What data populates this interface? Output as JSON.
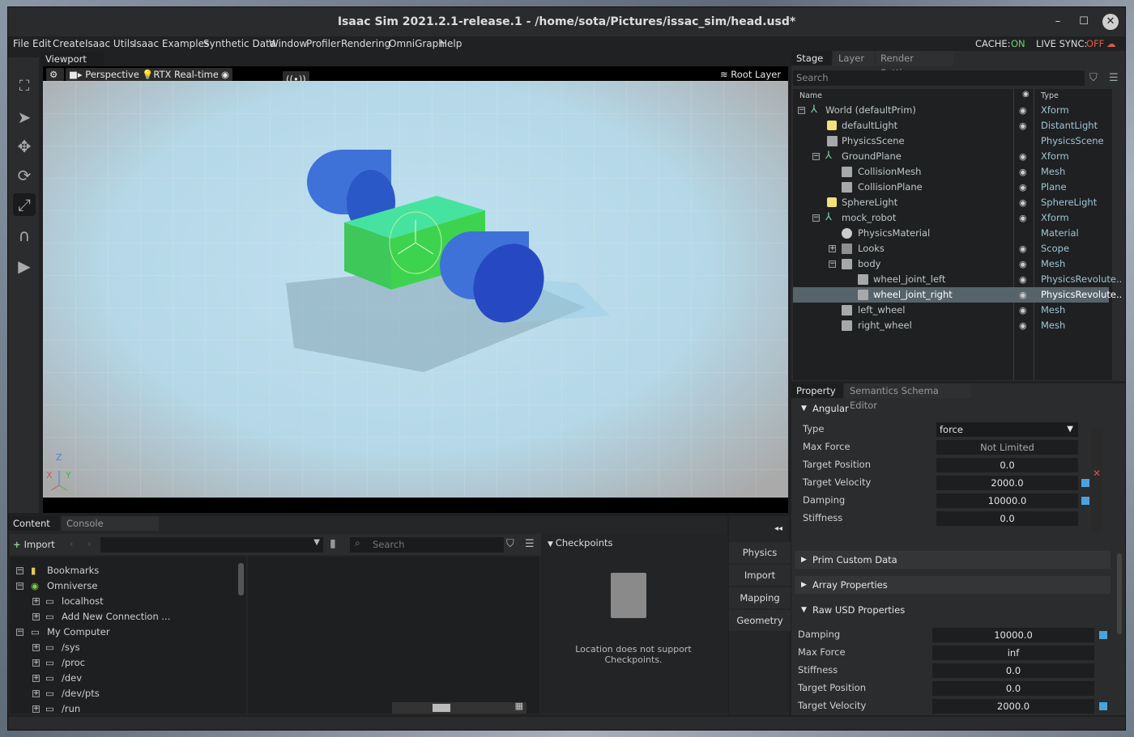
{
  "window": {
    "title": "Isaac Sim 2021.2.1-release.1 - /home/sota/Pictures/issac_sim/head.usd*",
    "minimize": "–",
    "maximize": "☐",
    "close": "✕"
  },
  "menu": [
    "File",
    "Edit",
    "Create",
    "Isaac Utils",
    "Isaac Examples",
    "Synthetic Data",
    "Window",
    "Profiler",
    "Rendering",
    "OmniGraph",
    "Help"
  ],
  "status": {
    "cache_label": "CACHE:",
    "cache_value": "ON",
    "live_label": "LIVE SYNC:",
    "live_value": "OFF"
  },
  "viewport": {
    "tab": "Viewport",
    "camera": "Perspective",
    "renderer": "RTX Real-time",
    "root_layer": "Root Layer",
    "axis_z": "Z",
    "axis_x": "X",
    "axis_y": "Y"
  },
  "stage": {
    "tabs": [
      "Stage",
      "Layer",
      "Render Settings"
    ],
    "search_placeholder": "Search",
    "col_name": "Name",
    "col_type": "Type",
    "rows": [
      {
        "name": "World (defaultPrim)",
        "type": "Xform",
        "eye": true
      },
      {
        "name": "defaultLight",
        "type": "DistantLight",
        "eye": true
      },
      {
        "name": "PhysicsScene",
        "type": "PhysicsScene",
        "eye": false
      },
      {
        "name": "GroundPlane",
        "type": "Xform",
        "eye": true
      },
      {
        "name": "CollisionMesh",
        "type": "Mesh",
        "eye": true
      },
      {
        "name": "CollisionPlane",
        "type": "Plane",
        "eye": true
      },
      {
        "name": "SphereLight",
        "type": "SphereLight",
        "eye": true
      },
      {
        "name": "mock_robot",
        "type": "Xform",
        "eye": true
      },
      {
        "name": "PhysicsMaterial",
        "type": "Material",
        "eye": false
      },
      {
        "name": "Looks",
        "type": "Scope",
        "eye": true
      },
      {
        "name": "body",
        "type": "Mesh",
        "eye": true
      },
      {
        "name": "wheel_joint_left",
        "type": "PhysicsRevolute..",
        "eye": true
      },
      {
        "name": "wheel_joint_right",
        "type": "PhysicsRevolute..",
        "eye": true
      },
      {
        "name": "left_wheel",
        "type": "Mesh",
        "eye": true
      },
      {
        "name": "right_wheel",
        "type": "Mesh",
        "eye": true
      }
    ]
  },
  "property": {
    "tabs": [
      "Property",
      "Semantics Schema Editor"
    ],
    "angular_title": "Angular",
    "fields": [
      {
        "label": "Type",
        "value": "force"
      },
      {
        "label": "Max Force",
        "value": "Not Limited"
      },
      {
        "label": "Target Position",
        "value": "0.0"
      },
      {
        "label": "Target Velocity",
        "value": "2000.0"
      },
      {
        "label": "Damping",
        "value": "10000.0"
      },
      {
        "label": "Stiffness",
        "value": "0.0"
      }
    ],
    "sections": [
      "Prim Custom Data",
      "Array Properties",
      "Raw USD Properties"
    ],
    "raw": [
      {
        "label": "Damping",
        "value": "10000.0"
      },
      {
        "label": "Max Force",
        "value": "inf"
      },
      {
        "label": "Stiffness",
        "value": "0.0"
      },
      {
        "label": "Target Position",
        "value": "0.0"
      },
      {
        "label": "Target Velocity",
        "value": "2000.0"
      }
    ]
  },
  "content": {
    "tabs": [
      "Content",
      "Console"
    ],
    "import_label": "Import",
    "search_placeholder": "Search",
    "tree": [
      {
        "label": "Bookmarks",
        "exp": "−"
      },
      {
        "label": "Omniverse",
        "exp": "−"
      },
      {
        "label": "localhost",
        "exp": "+"
      },
      {
        "label": "Add New Connection ...",
        "exp": "+"
      },
      {
        "label": "My Computer",
        "exp": "−"
      },
      {
        "label": "/sys",
        "exp": "+"
      },
      {
        "label": "/proc",
        "exp": "+"
      },
      {
        "label": "/dev",
        "exp": "+"
      },
      {
        "label": "/dev/pts",
        "exp": "+"
      },
      {
        "label": "/run",
        "exp": "+"
      }
    ],
    "checkpoints_title": "Checkpoints",
    "checkpoints_msg": "Location does not support Checkpoints."
  },
  "side_buttons": [
    "Physics",
    "Import",
    "Mapping",
    "Geometry"
  ]
}
